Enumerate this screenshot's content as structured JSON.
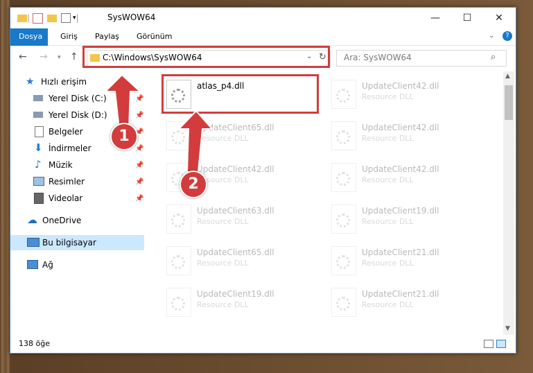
{
  "window": {
    "title": "SysWOW64"
  },
  "ribbon": {
    "tabs": [
      "Dosya",
      "Giriş",
      "Paylaş",
      "Görünüm"
    ]
  },
  "nav": {
    "address": "C:\\Windows\\SysWOW64",
    "search_placeholder": "Ara: SysWOW64"
  },
  "sidebar": {
    "items": [
      {
        "label": "Hızlı erişim",
        "icon": "star-icon"
      },
      {
        "label": "Yerel Disk (C:)",
        "icon": "drive-icon"
      },
      {
        "label": "Yerel Disk (D:)",
        "icon": "drive-icon"
      },
      {
        "label": "Belgeler",
        "icon": "documents-icon"
      },
      {
        "label": "İndirmeler",
        "icon": "download-icon"
      },
      {
        "label": "Müzik",
        "icon": "music-icon"
      },
      {
        "label": "Resimler",
        "icon": "pictures-icon"
      },
      {
        "label": "Videolar",
        "icon": "video-icon"
      },
      {
        "label": "OneDrive",
        "icon": "cloud-icon"
      },
      {
        "label": "Bu bilgisayar",
        "icon": "computer-icon"
      },
      {
        "label": "Ağ",
        "icon": "network-icon"
      }
    ]
  },
  "files": [
    {
      "name": "atlas_p4.dll",
      "type": ""
    },
    {
      "name": "UpdateClient42.dll",
      "type": "Resource DLL"
    },
    {
      "name": "UpdateClient65.dll",
      "type": "Resource DLL"
    },
    {
      "name": "UpdateClient42.dll",
      "type": "Resource DLL"
    },
    {
      "name": "UpdateClient42.dll",
      "type": "Resource DLL"
    },
    {
      "name": "UpdateClient42.dll",
      "type": "Resource DLL"
    },
    {
      "name": "UpdateClient63.dll",
      "type": "Resource DLL"
    },
    {
      "name": "UpdateClient19.dll",
      "type": "Resource DLL"
    },
    {
      "name": "UpdateClient65.dll",
      "type": "Resource DLL"
    },
    {
      "name": "UpdateClient21.dll",
      "type": "Resource DLL"
    },
    {
      "name": "UpdateClient19.dll",
      "type": "Resource DLL"
    },
    {
      "name": "UpdateClient21.dll",
      "type": "Resource DLL"
    }
  ],
  "status": {
    "count": "138 öğe"
  },
  "annotations": {
    "step1": "1",
    "step2": "2"
  },
  "colors": {
    "accent": "#1979ca",
    "highlight": "#d33c3c",
    "selected": "#cce8ff"
  }
}
